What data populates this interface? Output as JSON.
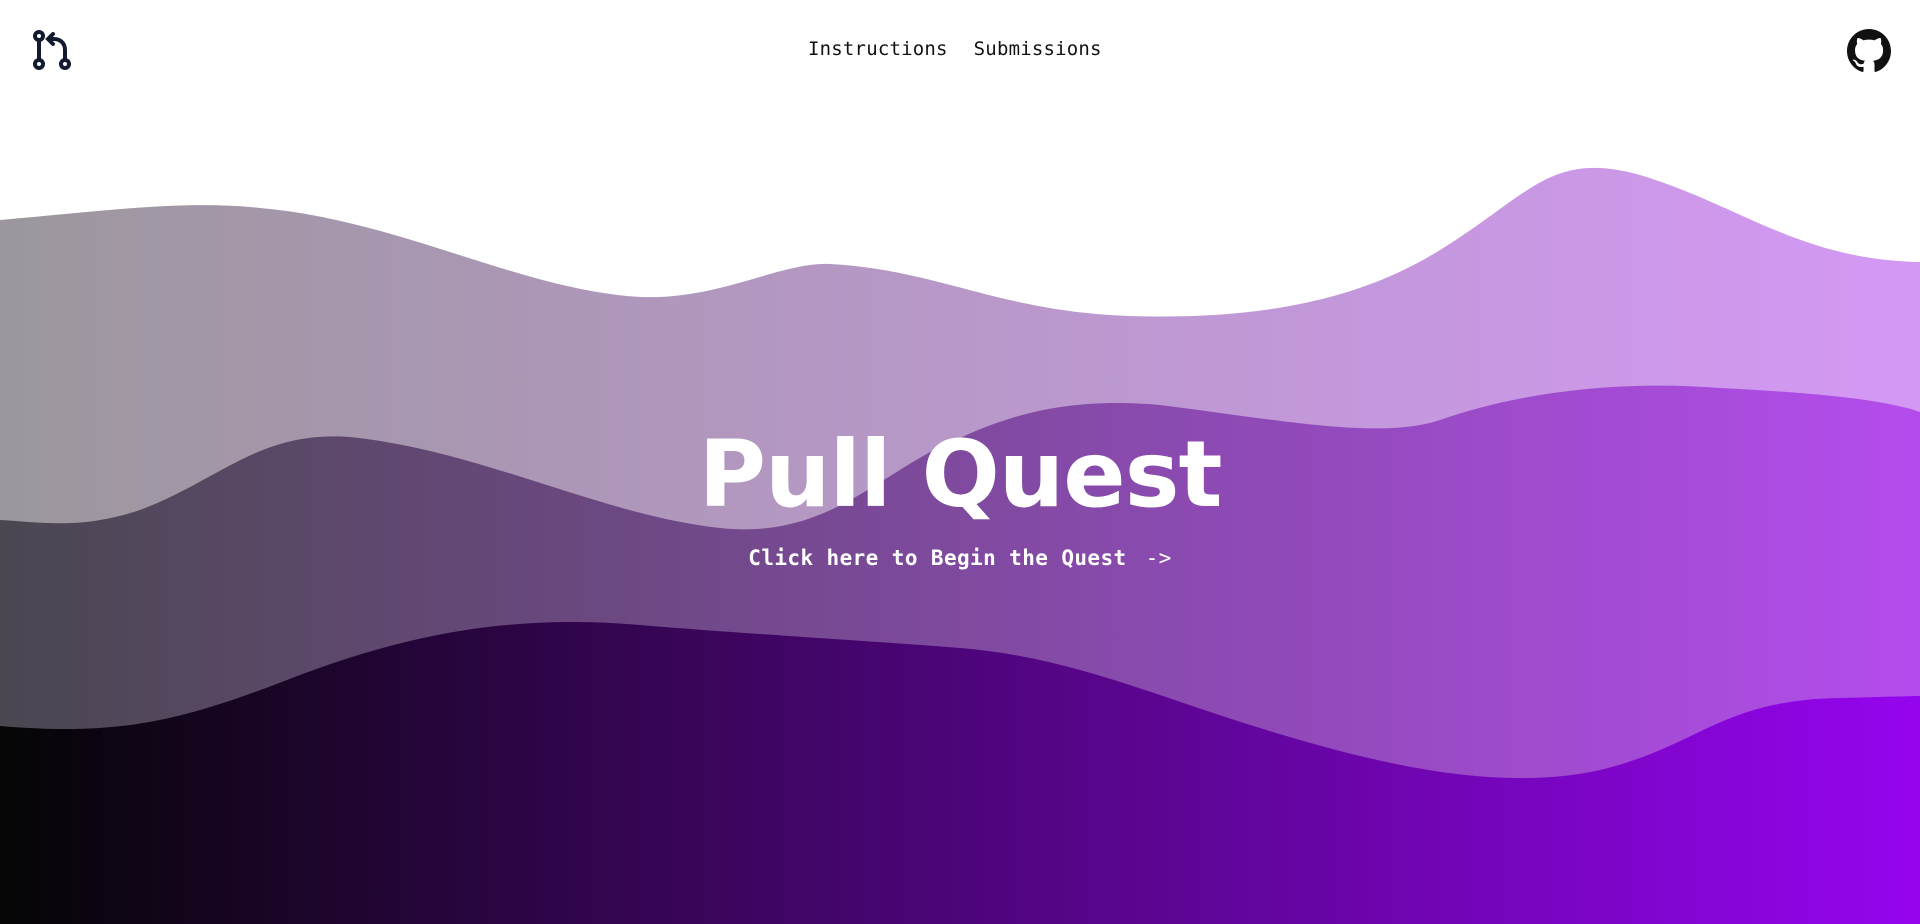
{
  "header": {
    "logo_icon": "git-pull-request-icon",
    "nav": [
      {
        "label": "Instructions"
      },
      {
        "label": "Submissions"
      }
    ],
    "github_icon": "github-icon"
  },
  "hero": {
    "title": "Pull Quest",
    "cta_label": "Click here to Begin the Quest",
    "cta_arrow": "->"
  },
  "colors": {
    "nav_text": "#111111",
    "hero_text": "#ffffff",
    "wave_back_start": "#9c979d",
    "wave_back_end": "#d498f5",
    "wave_mid_start": "#4a4750",
    "wave_mid_end": "#b44ced",
    "wave_front_start": "#050505",
    "wave_front_end": "#9505ef"
  }
}
